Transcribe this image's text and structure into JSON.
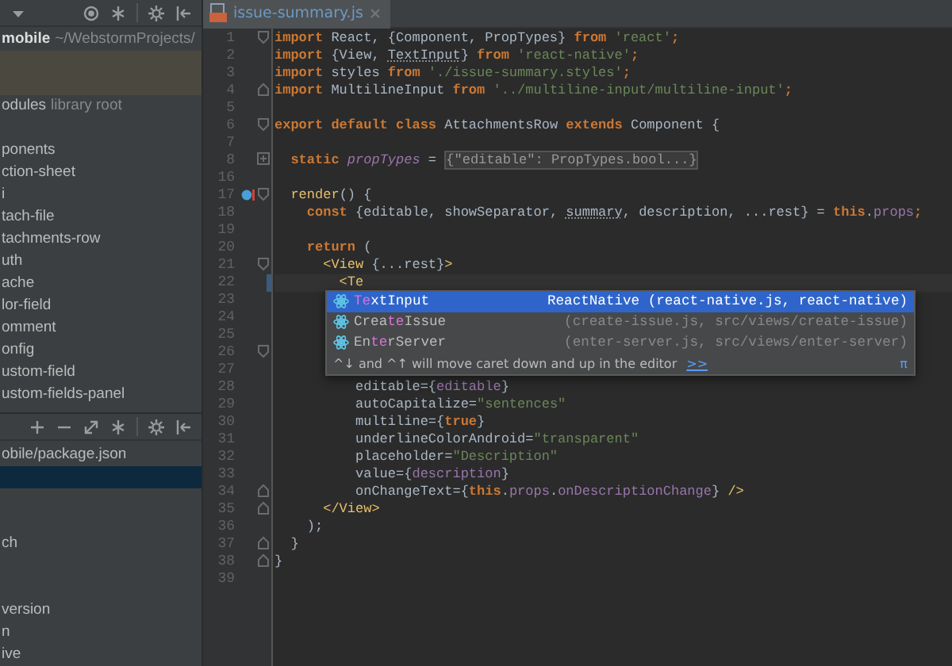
{
  "project_panel": {
    "rows": [
      {
        "kind": "item",
        "text": "mobile",
        "suffix": "~/WebstormProjects/",
        "bold": true,
        "highlighted": false,
        "selected": false
      },
      {
        "kind": "blank",
        "highlighted": true,
        "selected": false
      },
      {
        "kind": "blank",
        "highlighted": true,
        "selected": false
      },
      {
        "kind": "item",
        "text": "odules",
        "suffix": "library root",
        "bold": false,
        "highlighted": false,
        "selected": false
      },
      {
        "kind": "blank"
      },
      {
        "kind": "item",
        "text": "ponents",
        "bold": false,
        "highlighted": false,
        "selected": false
      },
      {
        "kind": "item",
        "text": "ction-sheet",
        "bold": false,
        "highlighted": false,
        "selected": false
      },
      {
        "kind": "item",
        "text": "i",
        "bold": false,
        "highlighted": false,
        "selected": false
      },
      {
        "kind": "item",
        "text": "tach-file",
        "bold": false,
        "highlighted": false,
        "selected": false
      },
      {
        "kind": "item",
        "text": "tachments-row",
        "bold": false,
        "highlighted": false,
        "selected": false
      },
      {
        "kind": "item",
        "text": "uth",
        "bold": false,
        "highlighted": false,
        "selected": false
      },
      {
        "kind": "item",
        "text": "ache",
        "bold": false,
        "highlighted": false,
        "selected": false
      },
      {
        "kind": "item",
        "text": "lor-field",
        "bold": false,
        "highlighted": false,
        "selected": false
      },
      {
        "kind": "item",
        "text": "omment",
        "bold": false,
        "highlighted": false,
        "selected": false
      },
      {
        "kind": "item",
        "text": "onfig",
        "bold": false,
        "highlighted": false,
        "selected": false
      },
      {
        "kind": "item",
        "text": "ustom-field",
        "bold": false,
        "highlighted": false,
        "selected": false
      },
      {
        "kind": "item",
        "text": "ustom-fields-panel",
        "bold": false,
        "highlighted": false,
        "selected": false
      }
    ]
  },
  "npm_panel": {
    "rows": [
      {
        "kind": "item",
        "text": "obile/package.json",
        "bold": false,
        "highlighted": false,
        "selected": false
      },
      {
        "kind": "blank",
        "highlighted": false,
        "selected": true
      },
      {
        "kind": "blank"
      },
      {
        "kind": "blank"
      },
      {
        "kind": "item",
        "text": "ch",
        "bold": false,
        "highlighted": false,
        "selected": false
      },
      {
        "kind": "blank"
      },
      {
        "kind": "blank"
      },
      {
        "kind": "item",
        "text": "version",
        "bold": false,
        "highlighted": false,
        "selected": false
      },
      {
        "kind": "item",
        "text": "n",
        "bold": false,
        "highlighted": false,
        "selected": false
      },
      {
        "kind": "item",
        "text": "ive",
        "bold": false,
        "highlighted": false,
        "selected": false
      }
    ]
  },
  "tabs": [
    {
      "label": "issue-summary.js",
      "selected": true
    }
  ],
  "editor": {
    "lines": [
      {
        "number": "1",
        "fold_start": true,
        "tokens": [
          {
            "kind": "keyword",
            "text": "import"
          },
          {
            "kind": "plain",
            "text": " React, {Component, PropTypes} "
          },
          {
            "kind": "keyword",
            "text": "from"
          },
          {
            "kind": "string",
            "text": " 'react'"
          },
          {
            "kind": "keyword",
            "text": ";"
          }
        ]
      },
      {
        "number": "2",
        "tokens": [
          {
            "kind": "keyword",
            "text": "import"
          },
          {
            "kind": "plain",
            "text": " {View, "
          },
          {
            "kind": "unused",
            "text": "TextInput"
          },
          {
            "kind": "plain",
            "text": "} "
          },
          {
            "kind": "keyword",
            "text": "from"
          },
          {
            "kind": "string",
            "text": " 'react-native'"
          },
          {
            "kind": "keyword",
            "text": ";"
          }
        ]
      },
      {
        "number": "3",
        "tokens": [
          {
            "kind": "keyword",
            "text": "import"
          },
          {
            "kind": "plain",
            "text": " styles "
          },
          {
            "kind": "keyword",
            "text": "from"
          },
          {
            "kind": "string",
            "text": " './issue-summary.styles'"
          },
          {
            "kind": "keyword",
            "text": ";"
          }
        ]
      },
      {
        "number": "4",
        "fold_end": true,
        "tokens": [
          {
            "kind": "keyword",
            "text": "import"
          },
          {
            "kind": "plain",
            "text": " MultilineInput "
          },
          {
            "kind": "keyword",
            "text": "from"
          },
          {
            "kind": "string",
            "text": " '../multiline-input/multiline-input'"
          },
          {
            "kind": "keyword",
            "text": ";"
          }
        ]
      },
      {
        "number": "5"
      },
      {
        "number": "6",
        "fold_start": true,
        "tokens": [
          {
            "kind": "keyword",
            "text": "export default class"
          },
          {
            "kind": "plain",
            "text": " AttachmentsRow "
          },
          {
            "kind": "keyword",
            "text": "extends"
          },
          {
            "kind": "plain",
            "text": " Component {"
          }
        ]
      },
      {
        "number": "7"
      },
      {
        "number": "8",
        "collapsed": true,
        "tokens": [
          {
            "kind": "keyword",
            "text": "  static"
          },
          {
            "kind": "field",
            "text": " propTypes"
          },
          {
            "kind": "plain",
            "text": " = "
          },
          {
            "kind": "folded",
            "text": "{\"editable\": PropTypes.bool...}"
          }
        ]
      },
      {
        "number": "16"
      },
      {
        "number": "17",
        "fold_start": true,
        "breakpoint": true,
        "tokens": [
          {
            "kind": "tag",
            "text": "  render"
          },
          {
            "kind": "plain",
            "text": "() {"
          }
        ]
      },
      {
        "number": "18",
        "tokens": [
          {
            "kind": "keyword",
            "text": "    const"
          },
          {
            "kind": "plain",
            "text": " {editable, showSeparator, "
          },
          {
            "kind": "unused",
            "text": "summary"
          },
          {
            "kind": "plain",
            "text": ", description, ...rest} = "
          },
          {
            "kind": "keyword",
            "text": "this"
          },
          {
            "kind": "plain",
            "text": "."
          },
          {
            "kind": "member",
            "text": "props"
          },
          {
            "kind": "keyword",
            "text": ";"
          }
        ]
      },
      {
        "number": "19"
      },
      {
        "number": "20",
        "tokens": [
          {
            "kind": "keyword",
            "text": "    return"
          },
          {
            "kind": "plain",
            "text": " ("
          }
        ]
      },
      {
        "number": "21",
        "fold_start": true,
        "tokens": [
          {
            "kind": "tag",
            "text": "      <View"
          },
          {
            "kind": "plain",
            "text": " {...rest}"
          },
          {
            "kind": "tag",
            "text": ">"
          }
        ]
      },
      {
        "number": "22",
        "current": true,
        "tokens": [
          {
            "kind": "tag",
            "text": "        <Te"
          }
        ]
      },
      {
        "number": "23"
      },
      {
        "number": "24"
      },
      {
        "number": "25"
      },
      {
        "number": "26",
        "fold_start": true
      },
      {
        "number": "27"
      },
      {
        "number": "28",
        "tokens": [
          {
            "kind": "plain",
            "text": "          editable={"
          },
          {
            "kind": "member",
            "text": "editable"
          },
          {
            "kind": "plain",
            "text": "}"
          }
        ]
      },
      {
        "number": "29",
        "tokens": [
          {
            "kind": "plain",
            "text": "          autoCapitalize="
          },
          {
            "kind": "string",
            "text": "\"sentences\""
          }
        ]
      },
      {
        "number": "30",
        "tokens": [
          {
            "kind": "plain",
            "text": "          multiline={"
          },
          {
            "kind": "keyword",
            "text": "true"
          },
          {
            "kind": "plain",
            "text": "}"
          }
        ]
      },
      {
        "number": "31",
        "tokens": [
          {
            "kind": "plain",
            "text": "          underlineColorAndroid="
          },
          {
            "kind": "string",
            "text": "\"transparent\""
          }
        ]
      },
      {
        "number": "32",
        "tokens": [
          {
            "kind": "plain",
            "text": "          placeholder="
          },
          {
            "kind": "string",
            "text": "\"Description\""
          }
        ]
      },
      {
        "number": "33",
        "tokens": [
          {
            "kind": "plain",
            "text": "          value={"
          },
          {
            "kind": "member",
            "text": "description"
          },
          {
            "kind": "plain",
            "text": "}"
          }
        ]
      },
      {
        "number": "34",
        "fold_end": true,
        "tokens": [
          {
            "kind": "plain",
            "text": "          onChangeText={"
          },
          {
            "kind": "keyword",
            "text": "this"
          },
          {
            "kind": "plain",
            "text": "."
          },
          {
            "kind": "member",
            "text": "props"
          },
          {
            "kind": "plain",
            "text": "."
          },
          {
            "kind": "member",
            "text": "onDescriptionChange"
          },
          {
            "kind": "plain",
            "text": "}"
          },
          {
            "kind": "tag",
            "text": " />"
          }
        ]
      },
      {
        "number": "35",
        "fold_end": true,
        "tokens": [
          {
            "kind": "tag",
            "text": "      </View>"
          }
        ]
      },
      {
        "number": "36",
        "tokens": [
          {
            "kind": "plain",
            "text": "    );"
          }
        ]
      },
      {
        "number": "37",
        "fold_end": true,
        "tokens": [
          {
            "kind": "plain",
            "text": "  }"
          }
        ]
      },
      {
        "number": "38",
        "fold_end": true,
        "tokens": [
          {
            "kind": "plain",
            "text": "}"
          }
        ]
      },
      {
        "number": "39"
      }
    ]
  },
  "completion": {
    "items": [
      {
        "match": "Te",
        "after": "xtInput",
        "location": "ReactNative (react-native.js, react-native)",
        "selected": true
      },
      {
        "before": "Crea",
        "match": "te",
        "after": "Issue",
        "location": "(create-issue.js, src/views/create-issue)",
        "selected": false
      },
      {
        "before": "En",
        "match": "te",
        "after": "rServer",
        "location": "(enter-server.js, src/views/enter-server)",
        "selected": false
      }
    ],
    "hint": "^↓ and ^↑ will move caret down and up in the editor",
    "hint_link": ">>",
    "pi": "π"
  }
}
